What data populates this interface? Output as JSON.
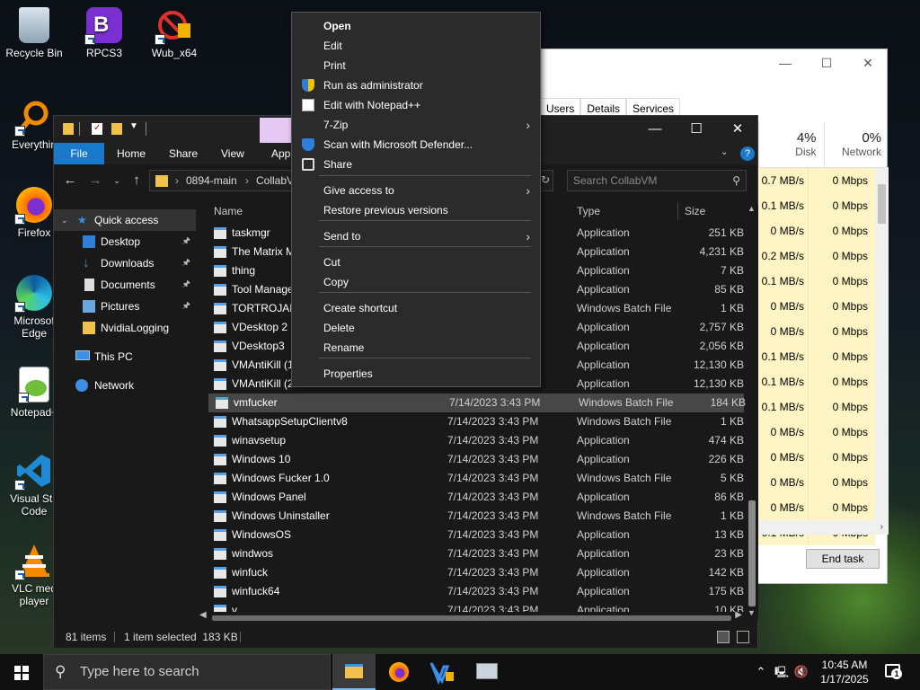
{
  "desktop_icons": [
    {
      "label": "Recycle Bin"
    },
    {
      "label": "RPCS3"
    },
    {
      "label": "Wub_x64"
    },
    {
      "label": "Everythin"
    },
    {
      "label": "Firefox"
    },
    {
      "label": "Microsoft Edge",
      "line1": "Microsof",
      "line2": "Edge"
    },
    {
      "label": "Notepad+"
    },
    {
      "label": "Visual Studio Code",
      "line1": "Visual Stu",
      "line2": "Code"
    },
    {
      "label": "VLC media player",
      "line1": "VLC med",
      "line2": "player"
    }
  ],
  "task_manager": {
    "tabs": [
      "Users",
      "Details",
      "Services"
    ],
    "columns": [
      {
        "percent": "4%",
        "name": "Disk"
      },
      {
        "percent": "0%",
        "name": "Network"
      }
    ],
    "rows": [
      {
        "disk": "0.7 MB/s",
        "network": "0 Mbps"
      },
      {
        "disk": "0.1 MB/s",
        "network": "0 Mbps"
      },
      {
        "disk": "0 MB/s",
        "network": "0 Mbps"
      },
      {
        "disk": "0.2 MB/s",
        "network": "0 Mbps"
      },
      {
        "disk": "0.1 MB/s",
        "network": "0 Mbps"
      },
      {
        "disk": "0 MB/s",
        "network": "0 Mbps"
      },
      {
        "disk": "0 MB/s",
        "network": "0 Mbps"
      },
      {
        "disk": "0.1 MB/s",
        "network": "0 Mbps"
      },
      {
        "disk": "0.1 MB/s",
        "network": "0 Mbps"
      },
      {
        "disk": "0.1 MB/s",
        "network": "0 Mbps"
      },
      {
        "disk": "0 MB/s",
        "network": "0 Mbps"
      },
      {
        "disk": "0 MB/s",
        "network": "0 Mbps"
      },
      {
        "disk": "0 MB/s",
        "network": "0 Mbps"
      },
      {
        "disk": "0 MB/s",
        "network": "0 Mbps"
      },
      {
        "disk": "0.1 MB/s",
        "network": "0 Mbps"
      }
    ],
    "end_task_label": "End task"
  },
  "explorer": {
    "ribbon_tabs": [
      "File",
      "Home",
      "Share",
      "View",
      "App"
    ],
    "address": {
      "segment1": "0894-main",
      "segment2": "CollabV"
    },
    "search_placeholder": "Search CollabVM",
    "nav": {
      "quick_access": "Quick access",
      "items": [
        "Desktop",
        "Downloads",
        "Documents",
        "Pictures",
        "NvidiaLogging"
      ],
      "this_pc": "This PC",
      "network": "Network"
    },
    "columns": {
      "name": "Name",
      "type": "Type",
      "size": "Size"
    },
    "files": [
      {
        "name": "taskmgr",
        "date": "",
        "type": "Application",
        "size": "251 KB"
      },
      {
        "name": "The Matrix M",
        "date": "",
        "type": "Application",
        "size": "4,231 KB"
      },
      {
        "name": "thing",
        "date": "",
        "type": "Application",
        "size": "7 KB"
      },
      {
        "name": "Tool Manage",
        "date": "",
        "type": "Application",
        "size": "85 KB"
      },
      {
        "name": "TORTROJAN",
        "date": "",
        "type": "Windows Batch File",
        "size": "1 KB"
      },
      {
        "name": "VDesktop 2",
        "date": "",
        "type": "Application",
        "size": "2,757 KB"
      },
      {
        "name": "VDesktop3",
        "date": "",
        "type": "Application",
        "size": "2,056 KB"
      },
      {
        "name": "VMAntiKill (1",
        "date": "",
        "type": "Application",
        "size": "12,130 KB"
      },
      {
        "name": "VMAntiKill (2",
        "date": "",
        "type": "Application",
        "size": "12,130 KB"
      },
      {
        "name": "vmfucker",
        "date": "7/14/2023 3:43 PM",
        "type": "Windows Batch File",
        "size": "184 KB",
        "selected": true
      },
      {
        "name": "WhatsappSetupClientv8",
        "date": "7/14/2023 3:43 PM",
        "type": "Windows Batch File",
        "size": "1 KB"
      },
      {
        "name": "winavsetup",
        "date": "7/14/2023 3:43 PM",
        "type": "Application",
        "size": "474 KB"
      },
      {
        "name": "Windows 10",
        "date": "7/14/2023 3:43 PM",
        "type": "Application",
        "size": "226 KB"
      },
      {
        "name": "Windows Fucker 1.0",
        "date": "7/14/2023 3:43 PM",
        "type": "Windows Batch File",
        "size": "5 KB"
      },
      {
        "name": "Windows Panel",
        "date": "7/14/2023 3:43 PM",
        "type": "Application",
        "size": "86 KB"
      },
      {
        "name": "Windows Uninstaller",
        "date": "7/14/2023 3:43 PM",
        "type": "Windows Batch File",
        "size": "1 KB"
      },
      {
        "name": "WindowsOS",
        "date": "7/14/2023 3:43 PM",
        "type": "Application",
        "size": "13 KB"
      },
      {
        "name": "windwos",
        "date": "7/14/2023 3:43 PM",
        "type": "Application",
        "size": "23 KB"
      },
      {
        "name": "winfuck",
        "date": "7/14/2023 3:43 PM",
        "type": "Application",
        "size": "142 KB"
      },
      {
        "name": "winfuck64",
        "date": "7/14/2023 3:43 PM",
        "type": "Application",
        "size": "175 KB"
      },
      {
        "name": "y",
        "date": "7/14/2023 3:43 PM",
        "type": "Application",
        "size": "10 KB"
      }
    ],
    "status": {
      "count": "81 items",
      "selection": "1 item selected  183 KB"
    }
  },
  "context_menu": {
    "items": [
      {
        "label": "Open",
        "bold": true
      },
      {
        "label": "Edit"
      },
      {
        "label": "Print"
      },
      {
        "label": "Run as administrator",
        "icon": "shield-icon"
      },
      {
        "label": "Edit with Notepad++",
        "icon": "notepad-icon"
      },
      {
        "label": "7-Zip",
        "submenu": true
      },
      {
        "label": "Scan with Microsoft Defender...",
        "icon": "defender-icon"
      },
      {
        "label": "Share",
        "icon": "share-icon"
      },
      {
        "label": "Give access to",
        "submenu": true
      },
      {
        "label": "Restore previous versions"
      },
      {
        "label": "Send to",
        "submenu": true
      },
      {
        "label": "Cut"
      },
      {
        "label": "Copy"
      },
      {
        "label": "Create shortcut"
      },
      {
        "label": "Delete"
      },
      {
        "label": "Rename"
      },
      {
        "label": "Properties"
      }
    ]
  },
  "taskbar": {
    "search_placeholder": "Type here to search",
    "time": "10:45 AM",
    "date": "1/17/2025",
    "notification_count": "1"
  },
  "colors": {
    "accent": "#1979ca",
    "selection": "#474747",
    "menu_bg": "#2b2b2b",
    "taskmgr_highlight": "#fff4c4"
  }
}
